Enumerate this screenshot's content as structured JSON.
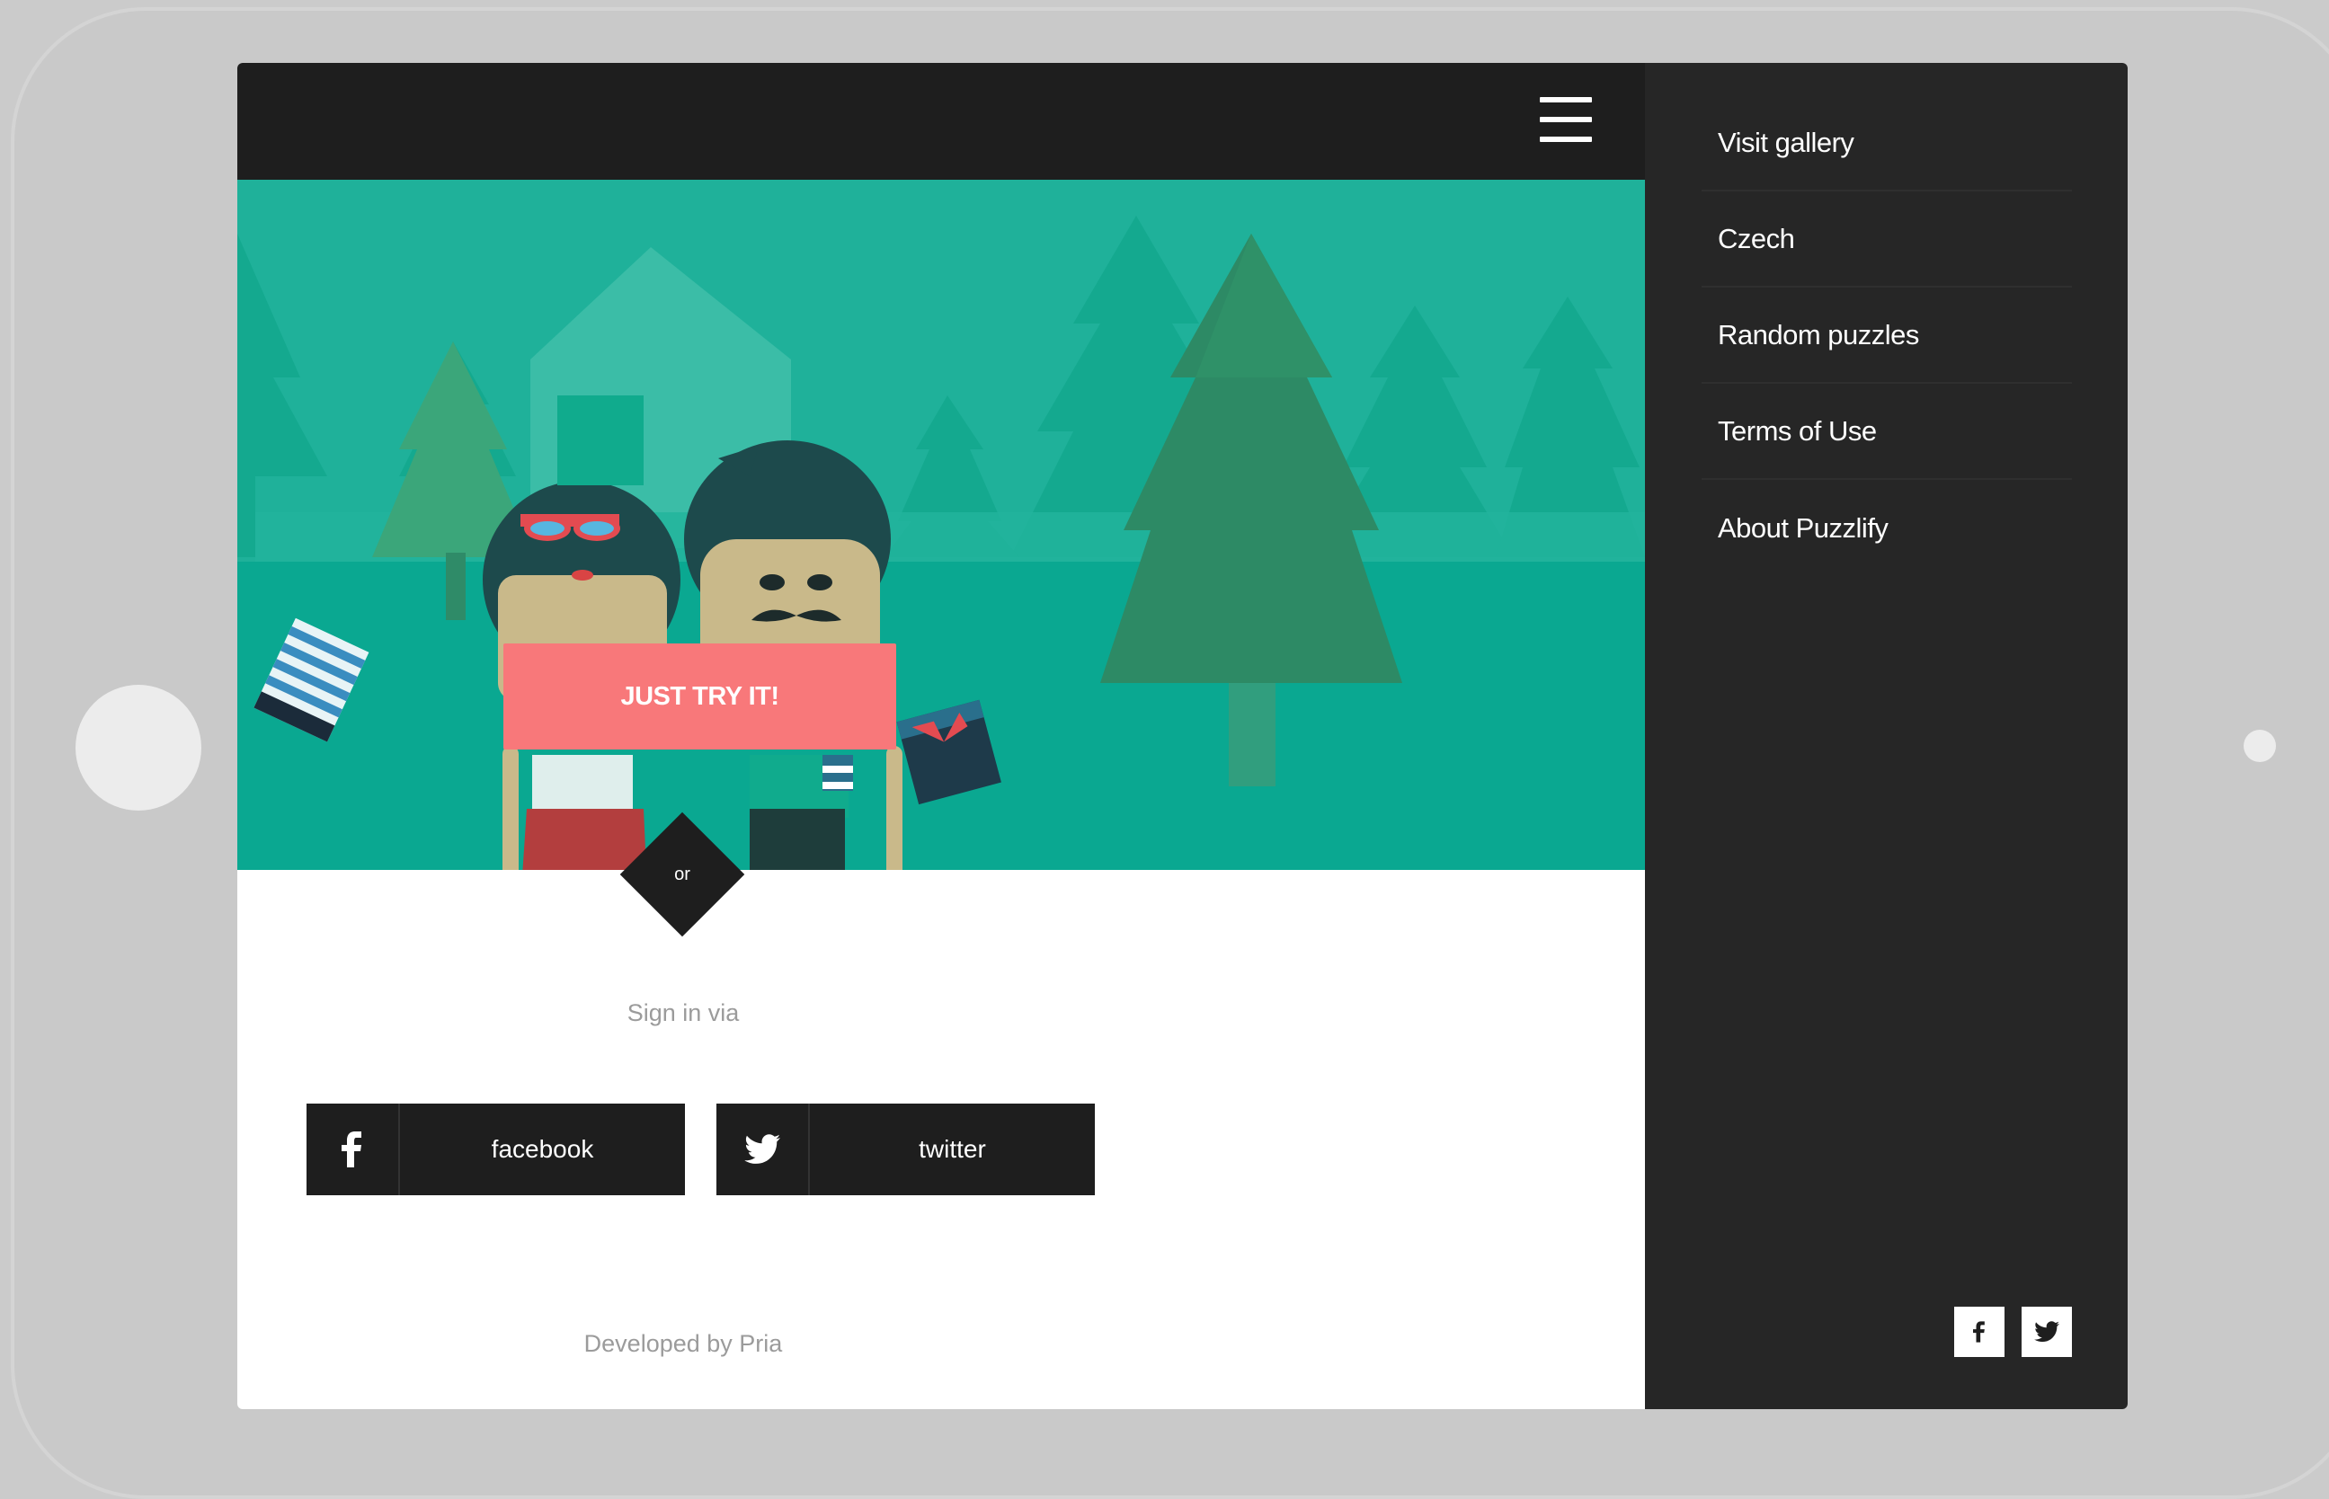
{
  "header": {
    "menu_icon": "hamburger-icon"
  },
  "hero": {
    "cta_label": "JUST TRY IT!",
    "or_label": "or",
    "background_color": "#0aa891"
  },
  "signin": {
    "label": "Sign in via",
    "buttons": [
      {
        "label": "facebook",
        "icon": "facebook-icon"
      },
      {
        "label": "twitter",
        "icon": "twitter-icon"
      }
    ]
  },
  "footer": {
    "developed_by": "Developed by Pria"
  },
  "sidemenu": {
    "items": [
      {
        "label": "Visit gallery"
      },
      {
        "label": "Czech"
      },
      {
        "label": "Random puzzles"
      },
      {
        "label": "Terms of Use"
      },
      {
        "label": "About Puzzlify"
      }
    ],
    "social": [
      {
        "icon": "facebook-icon"
      },
      {
        "icon": "twitter-icon"
      }
    ]
  },
  "colors": {
    "accent": "#f8787a",
    "dark": "#1e1e1e",
    "menu_bg": "#262626"
  }
}
